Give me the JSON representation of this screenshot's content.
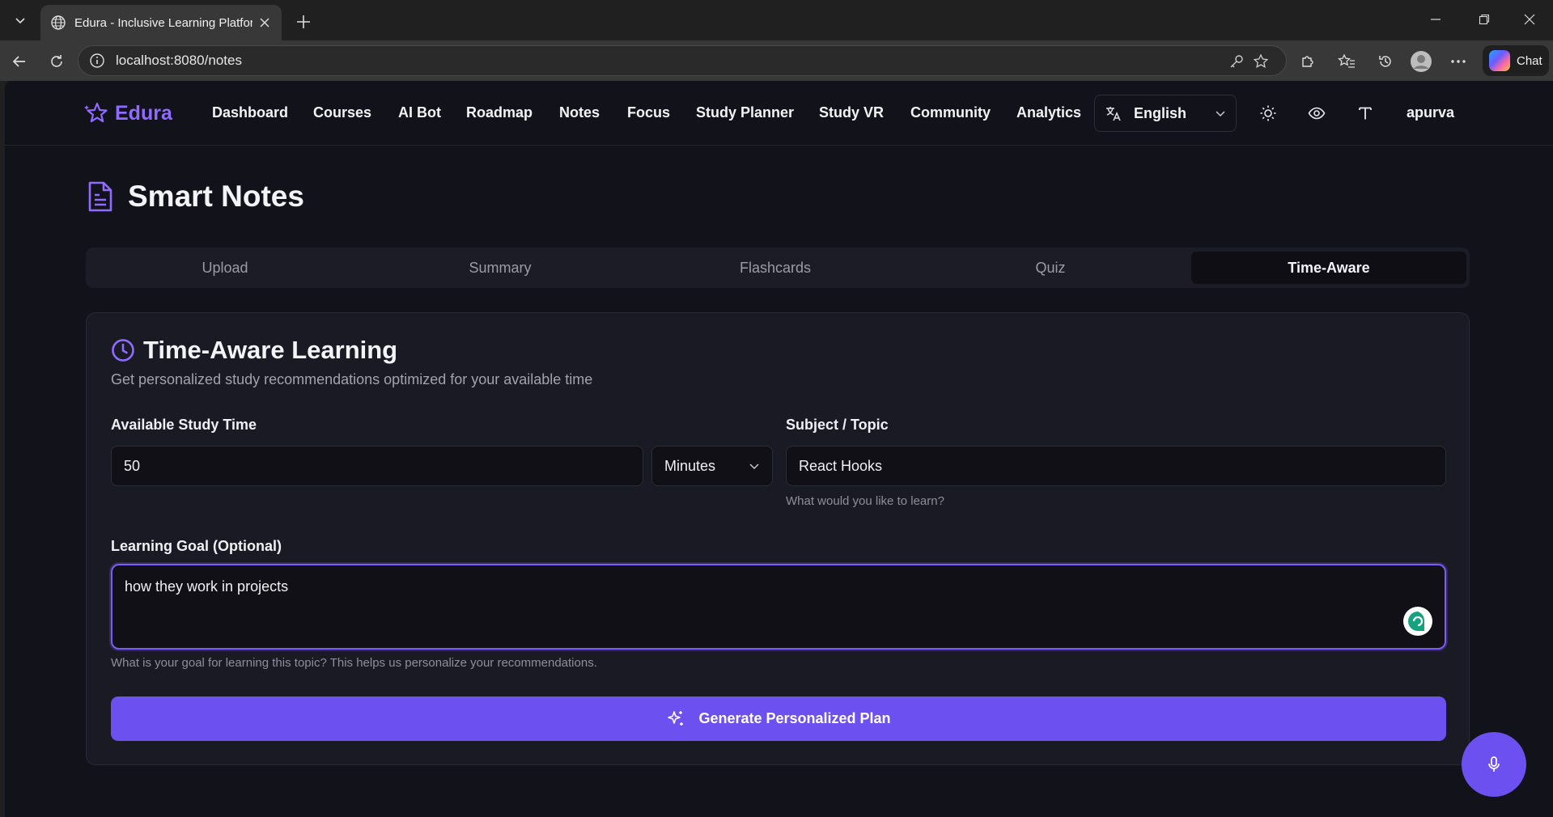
{
  "browser": {
    "tab_title": "Edura - Inclusive Learning Platform",
    "url": "localhost:8080/notes",
    "chat_label": "Chat"
  },
  "navbar": {
    "brand": "Edura",
    "items": [
      "Dashboard",
      "Courses",
      "AI Bot",
      "Roadmap",
      "Notes",
      "Focus",
      "Study Planner",
      "Study VR",
      "Community",
      "Analytics"
    ],
    "language": "English",
    "username": "apurva"
  },
  "page": {
    "title": "Smart Notes",
    "tabs": [
      {
        "label": "Upload",
        "active": false
      },
      {
        "label": "Summary",
        "active": false
      },
      {
        "label": "Flashcards",
        "active": false
      },
      {
        "label": "Quiz",
        "active": false
      },
      {
        "label": "Time-Aware",
        "active": true
      }
    ]
  },
  "card": {
    "title": "Time-Aware Learning",
    "subtitle": "Get personalized study recommendations optimized for your available time",
    "study_time": {
      "label": "Available Study Time",
      "value": "50",
      "unit": "Minutes"
    },
    "subject": {
      "label": "Subject / Topic",
      "value": "React Hooks",
      "helper": "What would you like to learn?"
    },
    "goal": {
      "label": "Learning Goal (Optional)",
      "value": "how they work in projects",
      "helper": "What is your goal for learning this topic? This helps us personalize your recommendations."
    },
    "generate_label": "Generate Personalized Plan"
  },
  "colors": {
    "accent": "#6c50f0",
    "brand": "#8f6bff",
    "background": "#12121a",
    "card": "#1a1a24"
  },
  "icons": {
    "logo": "sparkle-star-icon",
    "page_title": "document-icon",
    "card_title": "clock-icon",
    "generate": "sparkles-icon",
    "fab": "microphone-icon",
    "grammarly": "grammarly-icon"
  }
}
